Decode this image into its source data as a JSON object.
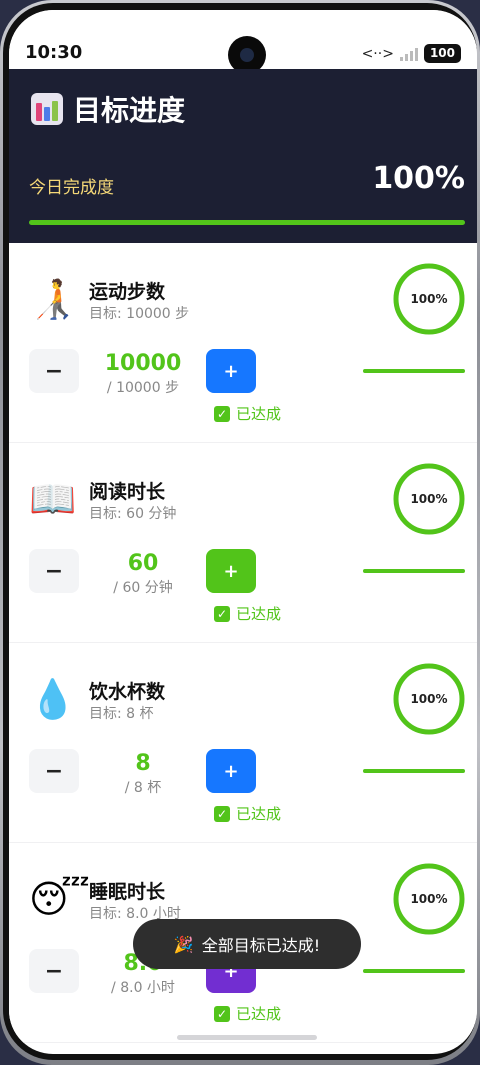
{
  "status_bar": {
    "time": "10:30",
    "data_indicator": "<··>",
    "battery": "100"
  },
  "header": {
    "title": "目标进度",
    "today_label": "今日完成度",
    "today_percent": "100%",
    "today_progress": 1.0
  },
  "goals": [
    {
      "emoji": "🧑‍🦯",
      "name": "运动步数",
      "target": "目标: 10000 步",
      "ring_label": "100%",
      "progress": 1.0,
      "current": "10000",
      "unit": "/ 10000 步",
      "minus_label": "−",
      "plus_label": "+",
      "plus_color": "#1677ff",
      "achieved_label": "已达成"
    },
    {
      "emoji": "📖",
      "name": "阅读时长",
      "target": "目标: 60 分钟",
      "ring_label": "100%",
      "progress": 1.0,
      "current": "60",
      "unit": "/ 60 分钟",
      "minus_label": "−",
      "plus_label": "+",
      "plus_color": "#52c41a",
      "achieved_label": "已达成"
    },
    {
      "emoji": "💧",
      "name": "饮水杯数",
      "target": "目标: 8 杯",
      "ring_label": "100%",
      "progress": 1.0,
      "current": "8",
      "unit": "/ 8 杯",
      "minus_label": "−",
      "plus_label": "+",
      "plus_color": "#1677ff",
      "achieved_label": "已达成"
    },
    {
      "emoji": "😴",
      "name": "睡眠时长",
      "target": "目标: 8.0 小时",
      "ring_label": "100%",
      "progress": 1.0,
      "current": "8.0",
      "unit": "/ 8.0 小时",
      "minus_label": "−",
      "plus_label": "+",
      "plus_color": "#722ed1",
      "achieved_label": "已达成"
    }
  ],
  "toast": {
    "emoji": "🎉",
    "text": "全部目标已达成!"
  },
  "colors": {
    "header_bg": "#1c1f33",
    "accent_green": "#52c41a",
    "today_label": "#f5d878"
  }
}
